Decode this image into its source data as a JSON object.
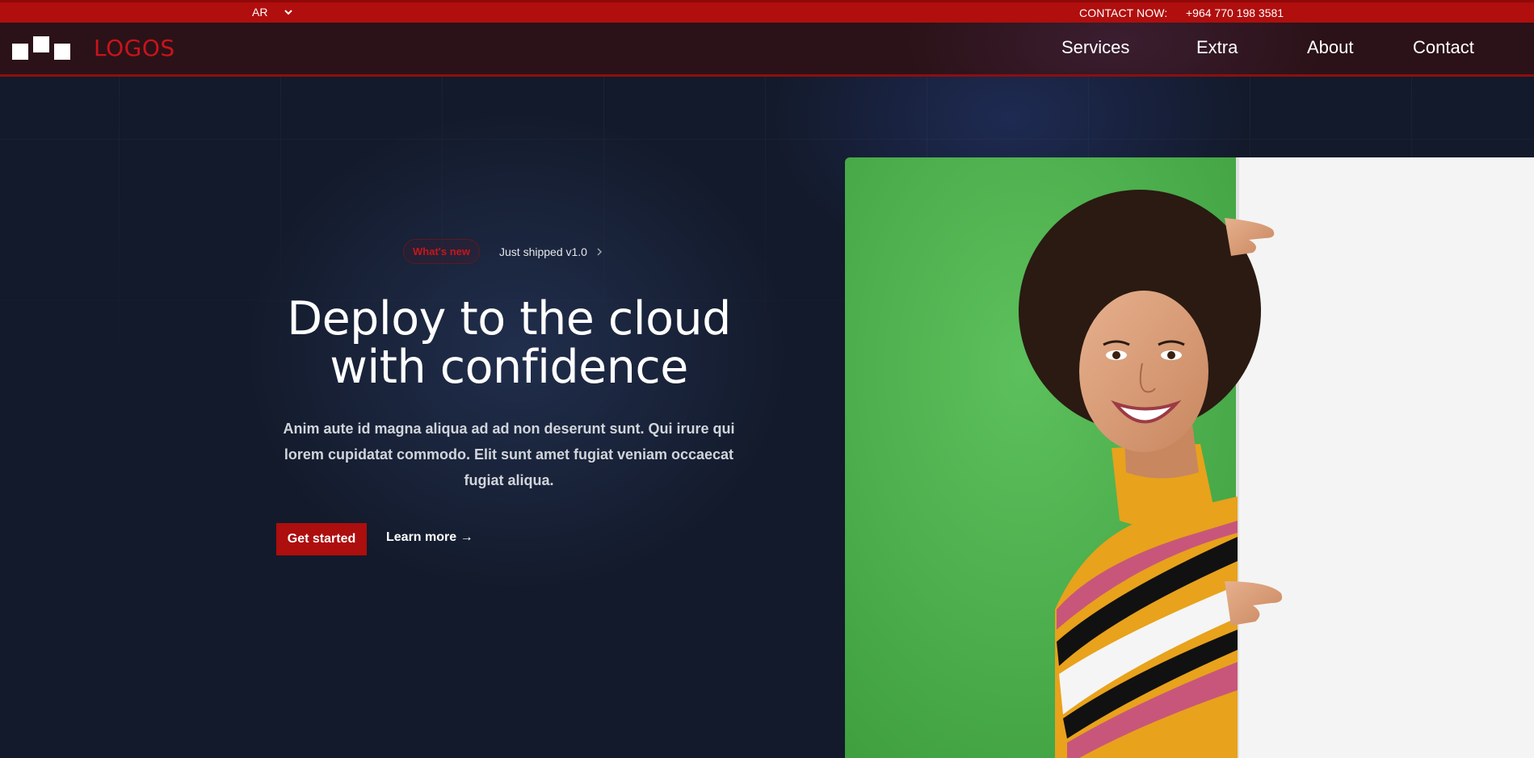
{
  "topbar": {
    "language": "AR",
    "contact_label": "CONTACT NOW:",
    "phone": "+964 770 198 3581"
  },
  "navbar": {
    "logo_text": "LOGOS",
    "items": [
      {
        "label": "Services"
      },
      {
        "label": "Extra"
      },
      {
        "label": "About"
      },
      {
        "label": "Contact"
      }
    ]
  },
  "hero": {
    "badge": "What's new",
    "announcement": "Just shipped v1.0",
    "headline_line1": "Deploy to the cloud",
    "headline_line2": "with confidence",
    "description": "Anim aute id magna aliqua ad ad non deserunt sunt. Qui irure qui lorem cupidatat commodo. Elit sunt amet fugiat veniam occaecat fugiat aliqua.",
    "primary_button": "Get started",
    "secondary_link": "Learn more →",
    "image": "smiling-woman-peeking-behind-white-board"
  },
  "colors": {
    "brand_red": "#ad0e0e",
    "navbar_bg": "#2b1218",
    "hero_bg": "#131a2b",
    "image_green": "#4fb34f"
  },
  "icons": {
    "language_dropdown": "chevron-down-icon",
    "announcement_arrow": "chevron-right-icon"
  }
}
